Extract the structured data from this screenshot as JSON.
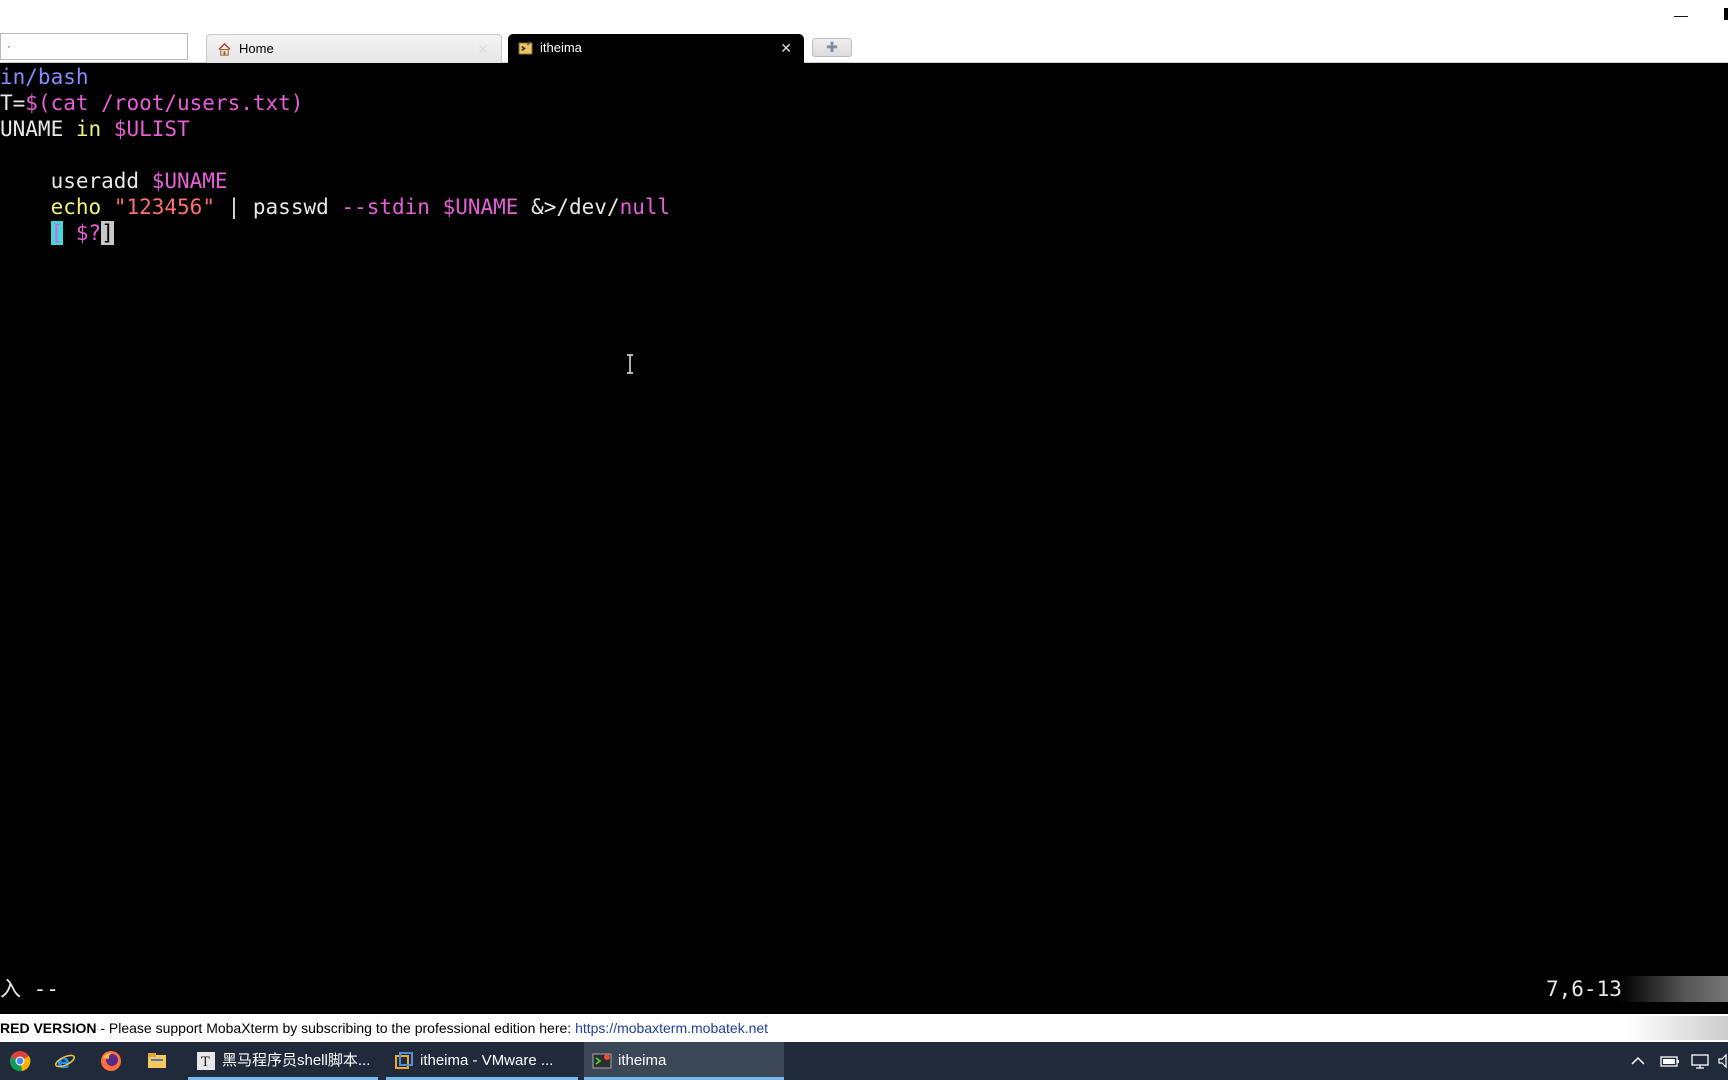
{
  "window": {
    "minimize_glyph": "—"
  },
  "tabs": {
    "quick_connect_value": "·",
    "items": [
      {
        "label": "Home",
        "icon": "home-icon"
      },
      {
        "label": "itheima",
        "icon": "terminal-icon"
      }
    ],
    "close_glyph": "✕",
    "new_tab_glyph": "✚"
  },
  "terminal": {
    "lines": [
      [
        "in/bash"
      ],
      [
        "T=",
        "$(cat /root/users.txt)"
      ],
      [
        "UNAME ",
        "in",
        " ",
        "$ULIST"
      ],
      [
        ""
      ],
      [
        "    useradd ",
        "$UNAME"
      ],
      [
        "    ",
        "echo",
        " ",
        "\"123456\"",
        " | passwd ",
        "--stdin",
        " ",
        "$UNAME",
        " &>/dev/",
        "null"
      ],
      [
        "    ",
        "[",
        " ",
        "$?",
        "]"
      ]
    ],
    "mode_text": "插入 --",
    "cursor_position": "7,6-13"
  },
  "banner": {
    "bold_text": "RED VERSION",
    "message": "  -  Please support MobaXterm by subscribing to the professional edition here:  ",
    "link": "https://mobaxterm.mobatek.net"
  },
  "taskbar": {
    "pinned": [
      "chrome-icon",
      "internet-explorer-icon",
      "firefox-icon",
      "file-explorer-icon"
    ],
    "apps": [
      {
        "label": "黑马程序员shell脚本...",
        "icon": "typora-icon"
      },
      {
        "label": "itheima - VMware ...",
        "icon": "vmware-icon"
      },
      {
        "label": "itheima",
        "icon": "mobaxterm-icon"
      }
    ]
  },
  "colors": {
    "titlebar": "#ffffff",
    "terminal_bg": "#000000",
    "taskbar_bg": "#202a3a",
    "accent": "#76b9ed"
  }
}
